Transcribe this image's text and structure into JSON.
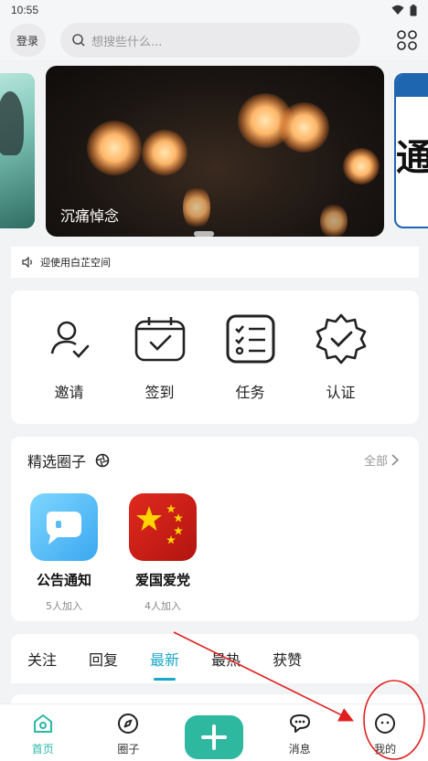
{
  "status_bar": {
    "time": "10:55"
  },
  "header": {
    "login_label": "登录",
    "search_placeholder": "想搜些什么..."
  },
  "banner": {
    "caption": "沉痛悼念",
    "right_glyph": "通"
  },
  "notice": {
    "text": "迎使用白芷空间"
  },
  "quick_actions": [
    {
      "label": "邀请",
      "icon": "invite-user-icon"
    },
    {
      "label": "签到",
      "icon": "calendar-check-icon"
    },
    {
      "label": "任务",
      "icon": "task-list-icon"
    },
    {
      "label": "认证",
      "icon": "verified-badge-icon"
    }
  ],
  "circles": {
    "title": "精选圈子",
    "all_label": "全部",
    "items": [
      {
        "name": "公告通知",
        "count": "5人加入"
      },
      {
        "name": "爱国爱党",
        "count": "4人加入"
      }
    ]
  },
  "feed_tabs": [
    "关注",
    "回复",
    "最新",
    "最热",
    "获赞"
  ],
  "active_tab": "最新",
  "bottom_nav": {
    "home": "首页",
    "circle": "圈子",
    "message": "消息",
    "mine": "我的"
  },
  "colors": {
    "accent": "#2bb8a6",
    "tab_active": "#1ba7c9",
    "annotation": "#e02020"
  }
}
